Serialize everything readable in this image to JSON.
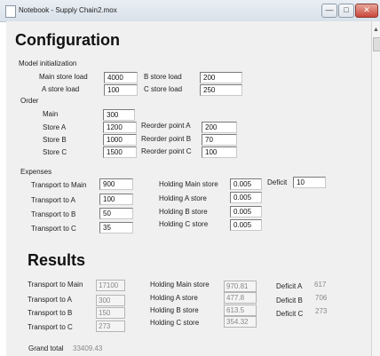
{
  "window": {
    "title": "Notebook - Supply Chain2.mox",
    "minimize": "—",
    "maximize": "□",
    "close": "✕"
  },
  "config": {
    "title": "Configuration",
    "model_init": {
      "label": "Model initialization",
      "main_store_load": {
        "label": "Main store load",
        "value": "4000"
      },
      "a_store_load": {
        "label": "A store load",
        "value": "100"
      },
      "b_store_load": {
        "label": "B store load",
        "value": "200"
      },
      "c_store_load": {
        "label": "C store load",
        "value": "250"
      }
    },
    "order": {
      "label": "Order",
      "main": {
        "label": "Main",
        "value": "300"
      },
      "store_a": {
        "label": "Store A",
        "value": "1200"
      },
      "store_b": {
        "label": "Store B",
        "value": "1000"
      },
      "store_c": {
        "label": "Store C",
        "value": "1500"
      },
      "reorder_a": {
        "label": "Reorder point A",
        "value": "200"
      },
      "reorder_b": {
        "label": "Reorder point B",
        "value": "70"
      },
      "reorder_c": {
        "label": "Reorder point C",
        "value": "100"
      }
    },
    "expenses": {
      "label": "Expenses",
      "transport_main": {
        "label": "Transport to Main",
        "value": "900"
      },
      "transport_a": {
        "label": "Transport to A",
        "value": "100"
      },
      "transport_b": {
        "label": "Transport to B",
        "value": "50"
      },
      "transport_c": {
        "label": "Transport to C",
        "value": "35"
      },
      "holding_main": {
        "label": "Holding Main store",
        "value": "0.005"
      },
      "holding_a": {
        "label": "Holding A store",
        "value": "0.005"
      },
      "holding_b": {
        "label": "Holding B store",
        "value": "0.005"
      },
      "holding_c": {
        "label": "Holding C store",
        "value": "0.005"
      },
      "deficit": {
        "label": "Deficit",
        "value": "10"
      }
    }
  },
  "results": {
    "title": "Results",
    "transport_main": {
      "label": "Transport to Main",
      "value": "17100"
    },
    "transport_a": {
      "label": "Transport to A",
      "value": "300"
    },
    "transport_b": {
      "label": "Transport to B",
      "value": "150"
    },
    "transport_c": {
      "label": "Transport to C",
      "value": "273"
    },
    "holding_main": {
      "label": "Holding Main store",
      "value": "970.81"
    },
    "holding_a": {
      "label": "Holding A store",
      "value": "477.8"
    },
    "holding_b": {
      "label": "Holding B store",
      "value": "613.5"
    },
    "holding_c": {
      "label": "Holding C store",
      "value": "354.32"
    },
    "deficit_a": {
      "label": "Deficit A",
      "value": "617"
    },
    "deficit_b": {
      "label": "Deficit B",
      "value": "706"
    },
    "deficit_c": {
      "label": "Deficit C",
      "value": "273"
    },
    "grand_total": {
      "label": "Grand total",
      "value": "33409.43"
    }
  }
}
